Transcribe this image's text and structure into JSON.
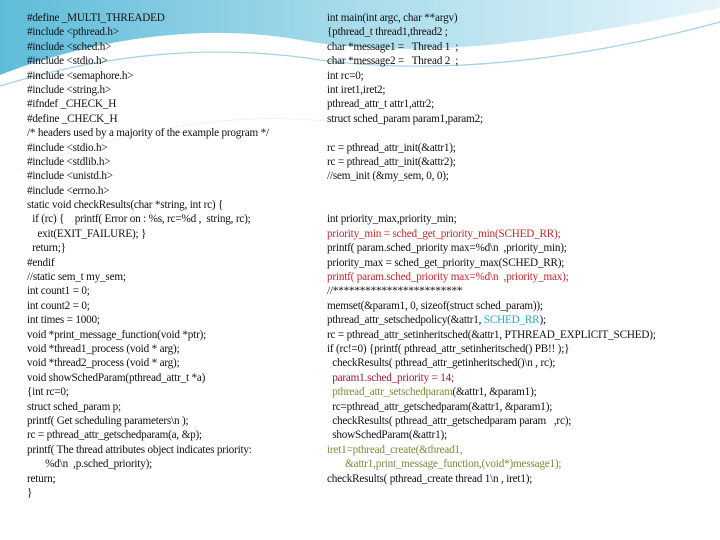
{
  "colors": {
    "text": "#111111",
    "red": "#c0282d",
    "dark_red": "#9b1b30",
    "olive": "#7d8a3c",
    "cyan": "#2aa7c9",
    "wave": "#8fd0e6"
  },
  "left_column": [
    [
      {
        "t": "#define _MULTI_THREADED"
      }
    ],
    [
      {
        "t": "#include <pthread.h>"
      }
    ],
    [
      {
        "t": "#include <sched.h>"
      }
    ],
    [
      {
        "t": "#include <stdio.h>"
      }
    ],
    [
      {
        "t": "#include <semaphore.h>"
      }
    ],
    [
      {
        "t": "#include <string.h>"
      }
    ],
    [
      {
        "t": "#ifndef _CHECK_H"
      }
    ],
    [
      {
        "t": "#define _CHECK_H"
      }
    ],
    [
      {
        "t": "/* headers used by a majority of the example program */"
      }
    ],
    [
      {
        "t": "#include <stdio.h>"
      }
    ],
    [
      {
        "t": "#include <stdlib.h>"
      }
    ],
    [
      {
        "t": "#include <unistd.h>"
      }
    ],
    [
      {
        "t": "#include <errno.h>"
      }
    ],
    [
      {
        "t": "static void checkResults(char *string, int rc) {"
      }
    ],
    [
      {
        "t": "  if (rc) {    printf( Error on : %s, rc=%d ,  string, rc);"
      }
    ],
    [
      {
        "t": "    exit(EXIT_FAILURE); }"
      }
    ],
    [
      {
        "t": "  return;}"
      }
    ],
    [
      {
        "t": "#endif"
      }
    ],
    [
      {
        "t": "//static sem_t my_sem;"
      }
    ],
    [
      {
        "t": "int count1 = 0;"
      }
    ],
    [
      {
        "t": "int count2 = 0;"
      }
    ],
    [
      {
        "t": "int times = 1000;"
      }
    ],
    [
      {
        "t": "void *print_message_function(void *ptr);"
      }
    ],
    [
      {
        "t": "void *thread1_process (void * arg);"
      }
    ],
    [
      {
        "t": "void *thread2_process (void * arg);"
      }
    ],
    [
      {
        "t": "void showSchedParam(pthread_attr_t *a)"
      }
    ],
    [
      {
        "t": "{int rc=0;"
      }
    ],
    [
      {
        "t": "struct sched_param p;"
      }
    ],
    [
      {
        "t": "printf( Get scheduling parameters\\n );"
      }
    ],
    [
      {
        "t": "rc = pthread_attr_getschedparam(a, &p);"
      }
    ],
    [
      {
        "t": "printf( The thread attributes object indicates priority:"
      }
    ],
    [
      {
        "t": "       %d\\n  ,p.sched_priority);"
      }
    ],
    [
      {
        "t": "return;"
      }
    ],
    [
      {
        "t": "}"
      }
    ]
  ],
  "right_column": [
    [
      {
        "t": "int main(int argc, char **argv)"
      }
    ],
    [
      {
        "t": "{pthread_t thread1,thread2 ;"
      }
    ],
    [
      {
        "t": "char *message1 =   Thread 1  ;"
      }
    ],
    [
      {
        "t": "char *message2 =   Thread 2  ;"
      }
    ],
    [
      {
        "t": "int rc=0;"
      }
    ],
    [
      {
        "t": "int iret1,iret2;"
      }
    ],
    [
      {
        "t": "pthread_attr_t attr1,attr2;"
      }
    ],
    [
      {
        "t": "struct sched_param param1,param2;"
      }
    ],
    [
      {
        "t": ""
      }
    ],
    [
      {
        "t": "rc = pthread_attr_init(&attr1);"
      }
    ],
    [
      {
        "t": "rc = pthread_attr_init(&attr2);"
      }
    ],
    [
      {
        "t": "//sem_init (&my_sem, 0, 0);"
      }
    ],
    [
      {
        "t": ""
      }
    ],
    [
      {
        "t": ""
      }
    ],
    [
      {
        "t": "int priority_max,priority_min;"
      }
    ],
    [
      {
        "t": "priority_min = sched_get_priority_min(SCHED_RR);",
        "c": "red"
      }
    ],
    [
      {
        "t": "printf( param.sched_priority max=%d\\n  ,priority_min);"
      }
    ],
    [
      {
        "t": "priority_max = sched_get_priority_max(SCHED_RR);"
      }
    ],
    [
      {
        "t": "printf( param.sched_priority max=%d\\n  ,priority_max);",
        "c": "red"
      }
    ],
    [
      {
        "t": "//************************"
      }
    ],
    [
      {
        "t": "memset(&param1, 0, sizeof(struct sched_param));"
      }
    ],
    [
      {
        "t": "pthread_attr_setschedpolicy(&attr1, "
      },
      {
        "t": "SCHED_RR",
        "c": "cyan"
      },
      {
        "t": ");"
      }
    ],
    [
      {
        "t": "rc = pthread_attr_setinheritsched(&attr1, PTHREAD_EXPLICIT_SCHED);"
      }
    ],
    [
      {
        "t": "if (rc!=0) {printf( pthread_attr_setinheritsched() PB!! );}"
      }
    ],
    [
      {
        "t": "  checkResults( pthread_attr_getinheritsched()\\n , rc);"
      }
    ],
    [
      {
        "t": "  param1.sched_priority = 14;",
        "c": "dark_red"
      }
    ],
    [
      {
        "t": "  pthread_attr_setschedparam",
        "c": "olive"
      },
      {
        "t": "(&attr1, &param1);"
      }
    ],
    [
      {
        "t": "  rc=pthread_attr_getschedparam(&attr1, &param1);"
      }
    ],
    [
      {
        "t": "  checkResults( pthread_attr_getschedparam param   ,rc);"
      }
    ],
    [
      {
        "t": "  showSchedParam(&attr1);"
      }
    ],
    [
      {
        "t": "iret1=pthread_create(&thread1,",
        "c": "olive"
      }
    ],
    [
      {
        "t": "       &attr1,print_message_function,(void*)message1);",
        "c": "olive"
      }
    ],
    [
      {
        "t": "checkResults( pthread_create thread 1\\n , iret1);"
      }
    ]
  ]
}
